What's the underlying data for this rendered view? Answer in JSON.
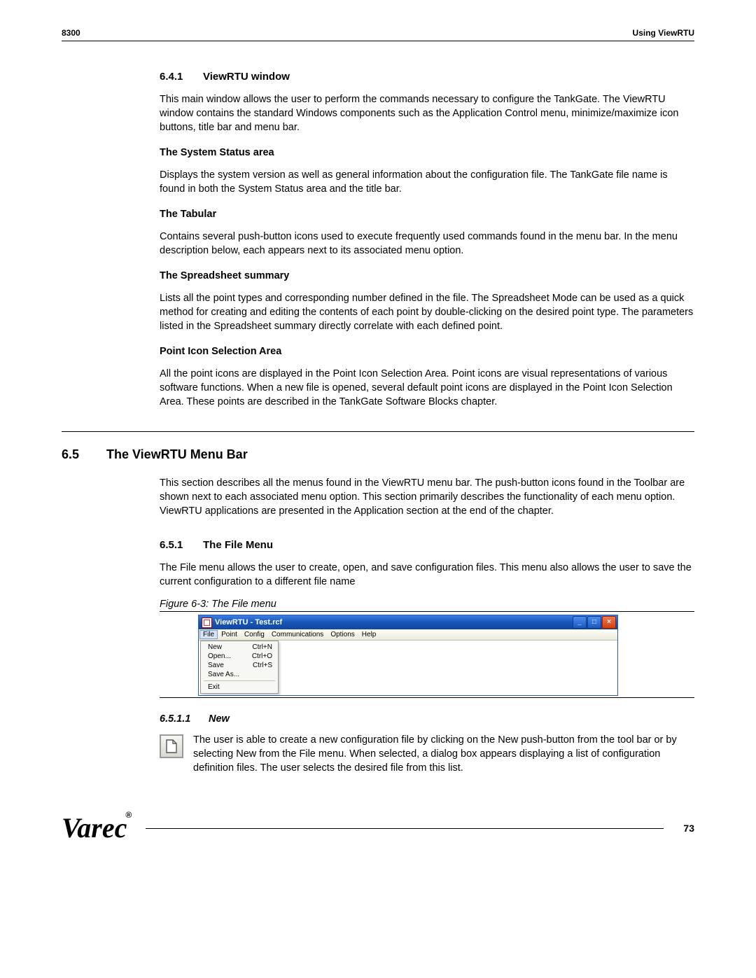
{
  "header": {
    "left": "8300",
    "right": "Using ViewRTU"
  },
  "s641": {
    "num": "6.4.1",
    "title": "ViewRTU window",
    "intro": "This main window allows the user to perform the commands necessary to configure the TankGate. The ViewRTU window contains the standard Windows components such as the Application Control menu, minimize/maximize icon buttons, title bar and menu bar.",
    "h1": "The System Status area",
    "p1": "Displays the system version as well as general information about the configuration file. The TankGate file name is found in both the System Status area and the title bar.",
    "h2": "The Tabular",
    "p2": "Contains several push-button icons used to execute frequently used commands found in the menu bar. In the menu description below, each appears next to its associated menu option.",
    "h3": "The Spreadsheet summary",
    "p3": "Lists all the point types and corresponding number defined in the file. The Spreadsheet Mode can be used as a quick method for creating and editing the contents of each point by double-clicking on the desired point type. The parameters listed in the Spreadsheet summary directly correlate with each defined point.",
    "h4": "Point Icon Selection Area",
    "p4": "All the point icons are displayed in the Point Icon Selection Area. Point icons are visual representations of various software functions. When a new file is opened, several default point icons are displayed in the Point Icon Selection Area. These points are described in the TankGate Software Blocks chapter."
  },
  "s65": {
    "num": "6.5",
    "title": "The ViewRTU Menu Bar",
    "intro": "This section describes all the menus found in the ViewRTU menu bar. The push-button icons found in the Toolbar are shown next to each associated menu option. This section primarily describes the functionality of each menu option. ViewRTU applications are presented in the Application section at the end of the chapter."
  },
  "s651": {
    "num": "6.5.1",
    "title": "The File Menu",
    "intro": "The File menu allows the user to create, open, and save configuration files. This menu also allows the user to save the current configuration to a different file name"
  },
  "figure": {
    "caption": "Figure 6-3:  The File menu",
    "window_title": "ViewRTU - Test.rcf",
    "menubar": [
      "File",
      "Point",
      "Config",
      "Communications",
      "Options",
      "Help"
    ],
    "dropdown": [
      {
        "label": "New",
        "shortcut": "Ctrl+N"
      },
      {
        "label": "Open...",
        "shortcut": "Ctrl+O"
      },
      {
        "label": "Save",
        "shortcut": "Ctrl+S"
      },
      {
        "label": "Save As...",
        "shortcut": ""
      }
    ],
    "dropdown_after_sep": [
      {
        "label": "Exit",
        "shortcut": ""
      }
    ]
  },
  "s6511": {
    "num": "6.5.1.1",
    "title": "New",
    "body": "The user is able to create a new configuration file by clicking on the New push-button from the tool bar or by selecting New from the File menu. When selected, a dialog box appears displaying a list of configuration definition files. The user selects the desired file from this list."
  },
  "footer": {
    "brand": "Varec",
    "brand_suffix": "®",
    "page": "73"
  }
}
